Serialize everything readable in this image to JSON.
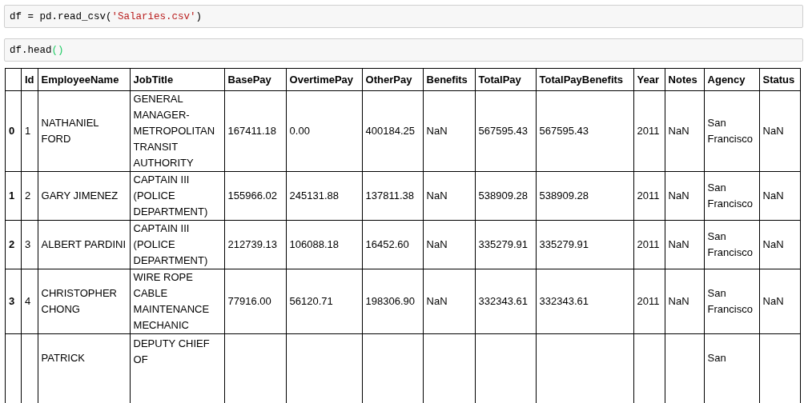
{
  "code_cells": [
    {
      "segments": [
        {
          "text": "df = pd.read_csv(",
          "kind": "plain"
        },
        {
          "text": "'Salaries.csv'",
          "kind": "string"
        },
        {
          "text": ")",
          "kind": "plain"
        }
      ]
    },
    {
      "segments": [
        {
          "text": "df.head",
          "kind": "plain"
        },
        {
          "text": "()",
          "kind": "bracket"
        }
      ]
    }
  ],
  "table": {
    "columns": [
      "",
      "Id",
      "EmployeeName",
      "JobTitle",
      "BasePay",
      "OvertimePay",
      "OtherPay",
      "Benefits",
      "TotalPay",
      "TotalPayBenefits",
      "Year",
      "Notes",
      "Agency",
      "Status"
    ],
    "rows": [
      {
        "cells": [
          "0",
          "1",
          "NATHANIEL FORD",
          "GENERAL MANAGER-METROPOLITAN TRANSIT AUTHORITY",
          "167411.18",
          "0.00",
          "400184.25",
          "NaN",
          "567595.43",
          "567595.43",
          "2011",
          "NaN",
          "San Francisco",
          "NaN"
        ]
      },
      {
        "cells": [
          "1",
          "2",
          "GARY JIMENEZ",
          "CAPTAIN III (POLICE DEPARTMENT)",
          "155966.02",
          "245131.88",
          "137811.38",
          "NaN",
          "538909.28",
          "538909.28",
          "2011",
          "NaN",
          "San Francisco",
          "NaN"
        ]
      },
      {
        "cells": [
          "2",
          "3",
          "ALBERT PARDINI",
          "CAPTAIN III (POLICE DEPARTMENT)",
          "212739.13",
          "106088.18",
          "16452.60",
          "NaN",
          "335279.91",
          "335279.91",
          "2011",
          "NaN",
          "San Francisco",
          "NaN"
        ]
      },
      {
        "cells": [
          "3",
          "4",
          "CHRISTOPHER CHONG",
          "WIRE ROPE CABLE MAINTENANCE MECHANIC",
          "77916.00",
          "56120.71",
          "198306.90",
          "NaN",
          "332343.61",
          "332343.61",
          "2011",
          "NaN",
          "San Francisco",
          "NaN"
        ]
      },
      {
        "cut": true,
        "cells": [
          "",
          "",
          "PATRICK",
          "DEPUTY CHIEF OF",
          "",
          "",
          "",
          "",
          "",
          "",
          "",
          "",
          "San",
          ""
        ]
      }
    ]
  }
}
